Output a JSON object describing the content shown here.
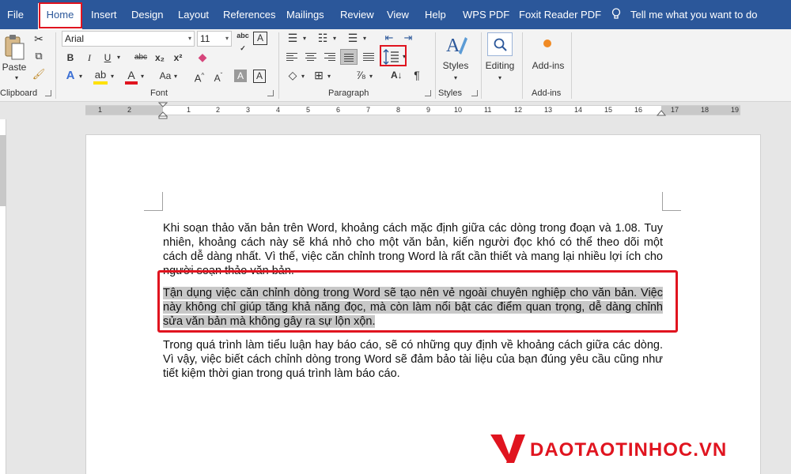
{
  "menu": {
    "tabs": [
      "File",
      "Home",
      "Insert",
      "Design",
      "Layout",
      "References",
      "Mailings",
      "Review",
      "View",
      "Help",
      "WPS PDF",
      "Foxit Reader PDF"
    ],
    "active": "Home",
    "tell_me": "Tell me what you want to do"
  },
  "ribbon": {
    "clipboard": {
      "paste": "Paste",
      "label": "Clipboard"
    },
    "font": {
      "name": "Arial",
      "size": "11",
      "label": "Font",
      "case_label": "abc",
      "aa_label": "Aa"
    },
    "paragraph": {
      "label": "Paragraph"
    },
    "styles": {
      "button": "Styles",
      "label": "Styles"
    },
    "editing": {
      "button": "Editing"
    },
    "addins": {
      "button": "Add-ins",
      "label": "Add-ins"
    }
  },
  "ruler": {
    "numbers": [
      "1",
      "2",
      "1",
      "2",
      "3",
      "4",
      "5",
      "6",
      "7",
      "8",
      "9",
      "10",
      "11",
      "12",
      "13",
      "14",
      "15",
      "16",
      "17",
      "18",
      "19"
    ]
  },
  "document": {
    "paragraphs": [
      "Khi soạn thảo văn bản trên Word, khoảng cách mặc định giữa các dòng trong đoạn và 1.08. Tuy nhiên, khoảng cách này sẽ khá nhỏ cho một văn bản, kiến người đọc khó có thể theo dõi một cách dễ dàng nhất. Vì thế, việc căn chỉnh trong Word là rất cần thiết và mang lại nhiều lợi ích cho người soạn thảo văn bản.",
      "Tận dụng việc căn chỉnh dòng trong Word sẽ tạo nên vẻ ngoài chuyên nghiệp cho văn bản. Việc này không chỉ giúp tăng khả năng đọc, mà còn làm nổi bật các điểm quan trọng, dễ dàng chỉnh sửa văn bản mà không gây ra sự lộn xộn.",
      "Trong quá trình làm tiểu luận hay báo cáo, sẽ có những quy định về khoảng cách giữa các dòng. Vì vậy, việc biết cách chỉnh dòng trong Word sẽ đảm bảo tài liệu của bạn đúng yêu cầu cũng như tiết kiệm thời gian trong quá trình làm báo cáo."
    ]
  },
  "watermark": {
    "text": "DAOTAOTINHOC.VN"
  },
  "colors": {
    "title_bar": "#2b579a",
    "highlight": "#e0141f",
    "selection": "#c8c8c8"
  }
}
